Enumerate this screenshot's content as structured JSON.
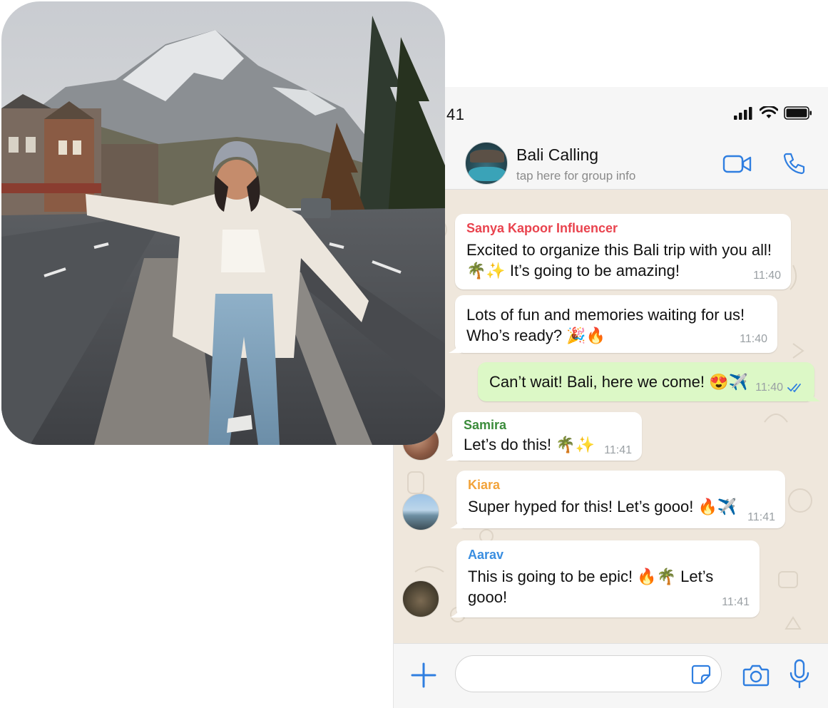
{
  "status_bar": {
    "time": "41"
  },
  "header": {
    "title": "Bali Calling",
    "subtitle": "tap here for group info"
  },
  "messages": [
    {
      "sender": "Sanya Kapoor Influencer",
      "sender_color": "#e9434e",
      "line1": "Excited to organize this Bali trip with you all!",
      "line2": "🌴✨ It’s going to be amazing!",
      "time": "11:40"
    },
    {
      "line1": "Lots of fun and memories waiting for us!",
      "line2": "Who’s ready? 🎉🔥",
      "time": "11:40"
    },
    {
      "outgoing": true,
      "line1": "Can’t wait! Bali, here we come! 😍✈️",
      "time": "11:40",
      "status": "read"
    },
    {
      "sender": "Samira",
      "sender_color": "#3b8c3b",
      "line1": "Let’s do this! 🌴✨",
      "time": "11:41"
    },
    {
      "sender": "Kiara",
      "sender_color": "#f2a33a",
      "line1": "Super hyped for this! Let’s gooo! 🔥✈️",
      "time": "11:41"
    },
    {
      "sender": "Aarav",
      "sender_color": "#3a8ee0",
      "line1": "This is going to be epic! 🔥🌴 Let’s",
      "line2": "gooo!",
      "time": "11:41"
    }
  ],
  "input": {
    "value": "",
    "placeholder": ""
  },
  "colors": {
    "accent": "#2f7ee0",
    "chat_bg": "#efe7dc",
    "outgoing_bubble": "#dcf8c6",
    "read_ticks": "#2f7ee0"
  },
  "icons": {
    "header": [
      "video-call-icon",
      "voice-call-icon"
    ],
    "input_bar": [
      "plus-icon",
      "sticker-icon",
      "camera-icon",
      "microphone-icon"
    ],
    "status": [
      "cellular-signal-icon",
      "wifi-icon",
      "battery-icon"
    ]
  }
}
